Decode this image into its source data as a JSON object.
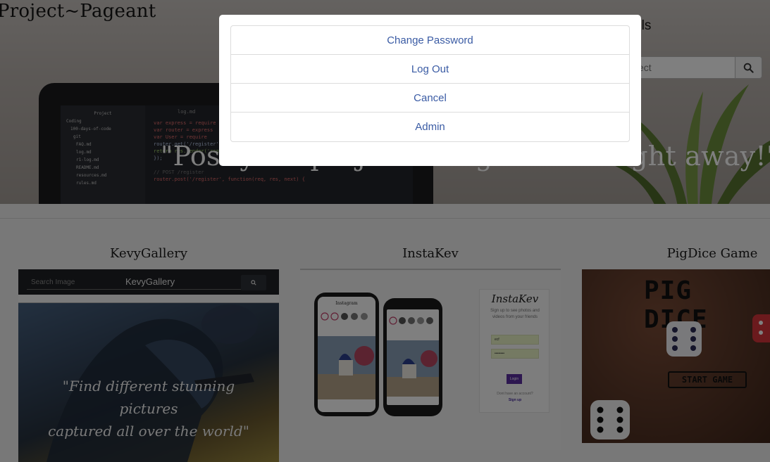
{
  "header": {
    "brand": "Project~Pageant",
    "nav_details": "etails",
    "search_placeholder": "h project",
    "tagline": "\"Post your project and get votes right away!\""
  },
  "hero_code": {
    "tree": [
      "Project",
      "Coding",
      "100-days-of-code",
      "git",
      "FAQ.md",
      "log.md",
      "r1-log.md",
      "README.md",
      "resources.md",
      "rules.md"
    ],
    "filename": "log.md",
    "lines": [
      "var express = require",
      "var router = express",
      "var User = require",
      "router.get('/register'",
      "  return res.render('register', { title: 'Sign Up' });",
      "});",
      "// POST /register",
      "router.post('/register', function(req, res, next) {"
    ]
  },
  "projects": [
    {
      "title": "KevyGallery",
      "search_placeholder": "Search Image",
      "logo": "KevyGallery",
      "quote_line1": "\"Find different stunning pictures",
      "quote_line2": "captured all over the world\""
    },
    {
      "title": "InstaKev",
      "panel_title": "InstaKev",
      "panel_sub": "Sign up to see photos and videos from your friends",
      "field_user": "ecf",
      "field_pass": "••••••••",
      "login_label": "Login",
      "foot_text": "Dont have an account?",
      "foot_link": "Sign up",
      "phone_header": "Instagram"
    },
    {
      "title": "PigDice Game",
      "game_title": "PIG DICE",
      "start_label": "START GAME"
    }
  ],
  "modal": {
    "items": [
      "Change Password",
      "Log Out",
      "Cancel",
      "Admin"
    ]
  },
  "colors": {
    "link": "#3a5ba4",
    "overlay": "rgba(0,0,0,0.5)",
    "instakev_accent": "#5b2fa0"
  },
  "icons": [
    "search-icon"
  ]
}
